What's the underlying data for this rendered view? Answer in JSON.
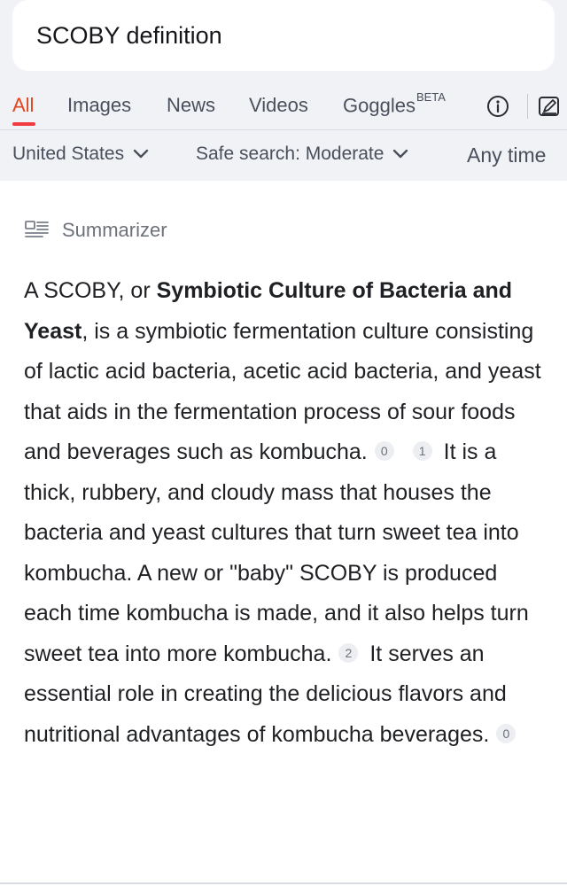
{
  "search": {
    "query": "SCOBY definition"
  },
  "tabs": [
    {
      "label": "All",
      "active": true
    },
    {
      "label": "Images"
    },
    {
      "label": "News"
    },
    {
      "label": "Videos"
    },
    {
      "label": "Goggles",
      "badge": "BETA"
    }
  ],
  "filters": {
    "region": "United States",
    "safe_search": "Safe search: Moderate",
    "time": "Any time"
  },
  "summarizer": {
    "label": "Summarizer",
    "segments": [
      {
        "t": "A SCOBY, or "
      },
      {
        "t": "Symbiotic Culture of Bacteria and Yeast",
        "b": true
      },
      {
        "t": ", is a symbiotic fermentation culture consisting of lactic acid bacteria, acetic acid bacteria, and yeast that aids in the fermentation process of sour foods and beverages such as kombucha."
      },
      {
        "c": "0"
      },
      {
        "c": "1"
      },
      {
        "t": "It is a thick, rubbery, and cloudy mass that houses the bacteria and yeast cultures that turn sweet tea into kombucha. A new or \"baby\" SCOBY is produced each time kombucha is made, and it also helps turn sweet tea into more kombucha."
      },
      {
        "c": "2"
      },
      {
        "t": "It serves an essential role in creating the delicious flavors and nutritional advantages of kombucha beverages."
      },
      {
        "c": "0"
      }
    ]
  },
  "colors": {
    "accent": "#e3451f",
    "tab_underline": "#ef3a3f",
    "header_bg": "#f0f2f5"
  },
  "icons": [
    "info-icon",
    "edit-icon",
    "chevron-down-icon",
    "summarizer-icon"
  ]
}
